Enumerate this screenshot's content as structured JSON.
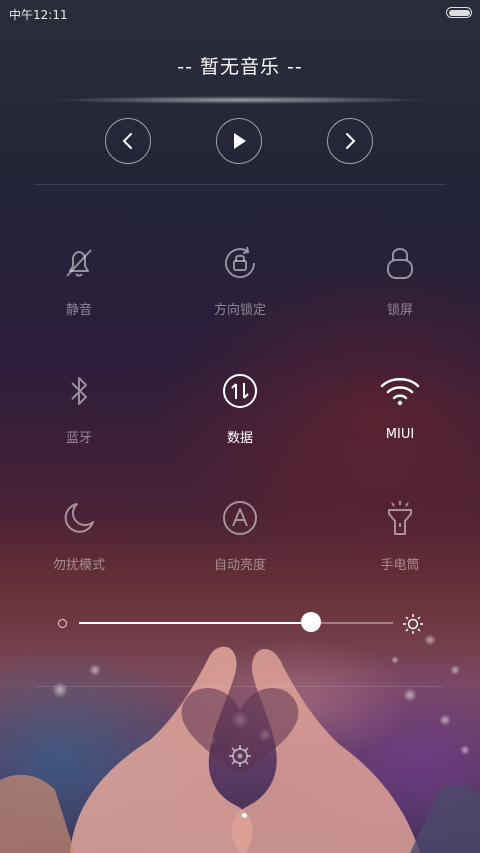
{
  "status_bar": {
    "time": "中午12:11"
  },
  "music": {
    "title": "-- 暂无音乐 --"
  },
  "toggles": [
    {
      "label": "静音",
      "icon": "mute-bell-icon",
      "active": false
    },
    {
      "label": "方向锁定",
      "icon": "rotation-lock-icon",
      "active": false
    },
    {
      "label": "锁屏",
      "icon": "lock-icon",
      "active": false
    },
    {
      "label": "蓝牙",
      "icon": "bluetooth-icon",
      "active": false
    },
    {
      "label": "数据",
      "icon": "mobile-data-icon",
      "active": true
    },
    {
      "label": "MIUI",
      "icon": "wifi-icon",
      "active": true
    },
    {
      "label": "勿扰模式",
      "icon": "moon-icon",
      "active": false
    },
    {
      "label": "自动亮度",
      "icon": "auto-brightness-icon",
      "active": false
    },
    {
      "label": "手电筒",
      "icon": "flashlight-icon",
      "active": false
    }
  ],
  "brightness": {
    "level": 0.74
  },
  "pager": {
    "current_page": 1
  }
}
